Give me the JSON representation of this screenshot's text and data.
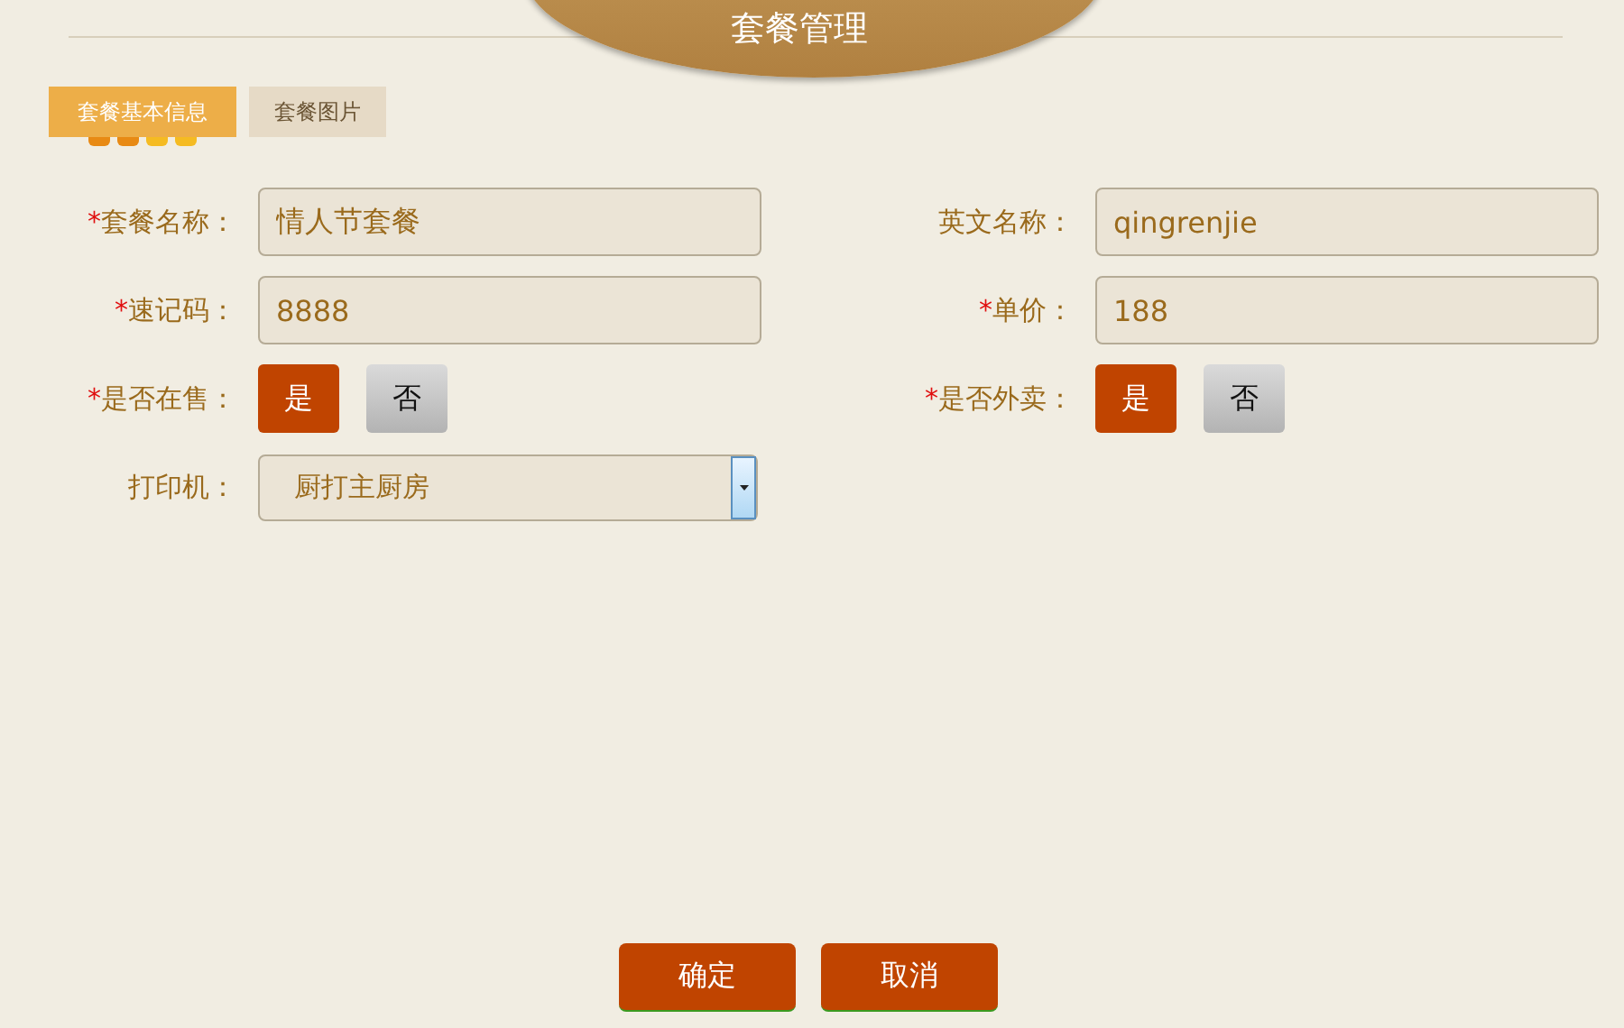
{
  "header": {
    "title": "套餐管理"
  },
  "tabs": [
    {
      "label": "套餐基本信息",
      "selected": true
    },
    {
      "label": "套餐图片",
      "selected": false
    }
  ],
  "form": {
    "left": [
      {
        "kind": "text",
        "mark": "*",
        "label": "套餐名称：",
        "value": "情人节套餐"
      },
      {
        "kind": "text",
        "mark": "*",
        "label": "速记码：",
        "value": "8888"
      },
      {
        "kind": "toggle",
        "mark": "*",
        "label": "是否在售：",
        "options": [
          {
            "label": "是",
            "selected": true
          },
          {
            "label": "否",
            "selected": false
          }
        ]
      },
      {
        "kind": "select",
        "label": "打印机：",
        "value": "厨打主厨房"
      }
    ],
    "right": [
      {
        "kind": "text",
        "label": "英文名称：",
        "value": "qingrenjie"
      },
      {
        "kind": "text",
        "mark": "*",
        "label": "单价：",
        "value": "188"
      },
      {
        "kind": "toggle",
        "mark": "*",
        "label": "是否外卖：",
        "options": [
          {
            "label": "是",
            "selected": true
          },
          {
            "label": "否",
            "selected": false
          }
        ]
      }
    ]
  },
  "buttons": [
    "确定",
    "取消"
  ]
}
